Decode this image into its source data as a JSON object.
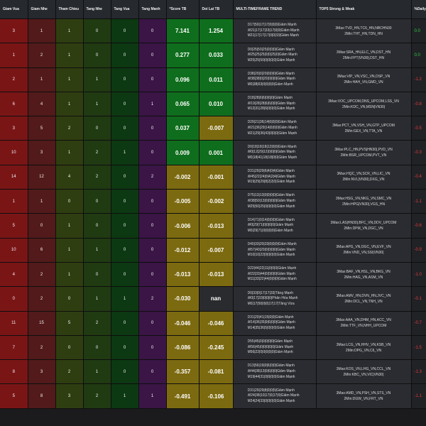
{
  "headers": [
    "Giam Vua",
    "Giam Nhe",
    "Tham Chieu",
    "Tang Nhe",
    "Tang Vua",
    "Tang Manh",
    "*Score TB",
    "Doi Lai TB",
    "MULTI-TIMEFRAME TREND",
    "TOP5 Strong & Weak",
    "%Daily"
  ],
  "colors": {
    "giam_vua": "#7a1516",
    "giam_nhe": "#521a1a",
    "tham_chieu": "#2f3e10",
    "tang_nhe": "#203a12",
    "tang_vua": "#0c3812",
    "tang_manh": "#3a1546",
    "metric_positive": "#0f6e1d",
    "metric_negative": "#7c6a10",
    "daily_up": "#2ecc40",
    "daily_down": "#e23b3b"
  },
  "rows": [
    {
      "giam_vua": "3",
      "giam_nhe": "1",
      "tham_chieu": "1",
      "tang_nhe": "0",
      "tang_vua": "0",
      "tang_manh": "0",
      "score": "7.141",
      "score_tone": "green",
      "doi_lai": "1.254",
      "doi_lai_tone": "green",
      "trend": [
        "D17|50|17|17|0|0|0|Giảm Mạnh",
        "W21|17|17|33|17|0|0|Giảm Mạnh",
        "M21|17|17|17|0|0|33|Giảm Mạnh"
      ],
      "top": [
        "3Max:TVD_HN,TC6_HN,NBCHN30",
        "2Min:THT_HN,TDN_HN"
      ],
      "daily": "0.0",
      "daily_tone": "up"
    },
    {
      "giam_vua": "1",
      "giam_nhe": "2",
      "tham_chieu": "1",
      "tang_nhe": "0",
      "tang_vua": "0",
      "tang_manh": "0",
      "score": "0.277",
      "score_tone": "green",
      "doi_lai": "0.033",
      "doi_lai_tone": "green",
      "trend": [
        "D0|25|50|25|0|0|0|Giảm Mạnh",
        "W25|25|25|0|0|25|0|Giảm Mạnh",
        "M25|25|50|0|0|0|0|Giảm Mạnh"
      ],
      "top": [
        "3Max:SRA_HN,ELC_VN,DST_HN",
        "2Min:FPT|VN30|,DST_HN"
      ],
      "daily": "0.0",
      "daily_tone": "up"
    },
    {
      "giam_vua": "2",
      "giam_nhe": "1",
      "tham_chieu": "1",
      "tang_nhe": "1",
      "tang_vua": "0",
      "tang_manh": "0",
      "score": "0.096",
      "score_tone": "green",
      "doi_lai": "0.011",
      "doi_lai_tone": "green",
      "trend": [
        "D38|20|0|20|0|0|0|Giảm Mạnh",
        "W38|38|0|20|0|0|0|Giảm Mạnh",
        "M0|38|63|0|0|0|0|Giảm Mạnh"
      ],
      "top": [
        "3Max:VIP_VN,VSC_VN,OSP_VN",
        "2Min:HAH_VN,GMD_VN"
      ],
      "daily": "-1.2",
      "daily_tone": "down"
    },
    {
      "giam_vua": "6",
      "giam_nhe": "4",
      "tham_chieu": "1",
      "tang_nhe": "1",
      "tang_vua": "0",
      "tang_manh": "1",
      "score": "0.065",
      "score_tone": "green",
      "doi_lai": "0.010",
      "doi_lai_tone": "green",
      "trend": [
        "D18|28|6|6|0|6|0|Giảm Mạnh",
        "W19|28|28|6|6|0|0|Giảm Mạnh",
        "M12|31|28|6|0|0|0|Giảm Mạnh"
      ],
      "top": [
        "3Max:VOC_UPCOM,DNS_UPCOM,LSS_VN",
        "2Min:KDC_VN,MSN|VN30|"
      ],
      "daily": "-0.8",
      "daily_tone": "down"
    },
    {
      "giam_vua": "3",
      "giam_nhe": "5",
      "tham_chieu": "2",
      "tang_nhe": "0",
      "tang_vua": "0",
      "tang_manh": "0",
      "score": "0.037",
      "score_tone": "green",
      "doi_lai": "-0.007",
      "doi_lai_tone": "olive",
      "trend": [
        "D29|21|36|14|0|0|0|Giảm Mạnh",
        "W21|36|29|14|0|0|0|Giảm Mạnh",
        "M21|29|36|43|0|0|0|Giảm Mạnh"
      ],
      "top": [
        "3Max:PCT_VN,VSH_VN,GTP_UPCOM",
        "2Min:GEX_VN,TTA_VN"
      ],
      "daily": "-0.5",
      "daily_tone": "down"
    },
    {
      "giam_vua": "10",
      "giam_nhe": "3",
      "tham_chieu": "1",
      "tang_nhe": "2",
      "tang_vua": "1",
      "tang_manh": "0",
      "score": "0.009",
      "score_tone": "green",
      "doi_lai": "0.001",
      "doi_lai_tone": "green",
      "trend": [
        "D0|18|18|18|12|0|0|Giảm Mạnh",
        "W0|12|29|12|0|0|0|Giảm Mạnh",
        "M0|18|41|18|18|0|0|Giảm Mạnh"
      ],
      "top": [
        "3Max:PLC_HN,PVS|HN30|,PVD_VN",
        "2Min:BSR_UPCOM,PVT_VN"
      ],
      "daily": "-0.3",
      "daily_tone": "down"
    },
    {
      "giam_vua": "14",
      "giam_nhe": "12",
      "tham_chieu": "4",
      "tang_nhe": "2",
      "tang_vua": "0",
      "tang_manh": "2",
      "score": "-0.002",
      "score_tone": "olive",
      "doi_lai": "-0.001",
      "doi_lai_tone": "olive",
      "trend": [
        "D31|29|29|6|4|0|4|Giảm Mạnh",
        "W45|22|24|0|4|2|4|Giảm Mạnh",
        "M19|29|29|8|2|2|0|Giảm Mạnh"
      ],
      "top": [
        "3Max:HQC_VN,SCR_VN,LIC_VN",
        "2Min:NVL|VN30|,DXG_VN"
      ],
      "daily": "-0.4",
      "daily_tone": "down"
    },
    {
      "giam_vua": "1",
      "giam_nhe": "1",
      "tham_chieu": "0",
      "tang_nhe": "0",
      "tang_vua": "0",
      "tang_manh": "0",
      "score": "-0.005",
      "score_tone": "olive",
      "doi_lai": "-0.002",
      "doi_lai_tone": "olive",
      "trend": [
        "D75|13|13|0|0|0|0|Giảm Mạnh",
        "W38|50|13|0|0|0|0|Giảm Mạnh",
        "M25|50|25|0|0|0|0|Giảm Mạnh"
      ],
      "top": [
        "3Max:HSG_VN,NKG_VN,SMC_VN",
        "2Min:HPG|VN30|,VGS_HN"
      ],
      "daily": "-1.1",
      "daily_tone": "down"
    },
    {
      "giam_vua": "5",
      "giam_nhe": "0",
      "tham_chieu": "1",
      "tang_nhe": "0",
      "tang_vua": "0",
      "tang_manh": "0",
      "score": "-0.006",
      "score_tone": "olive",
      "doi_lai": "-0.013",
      "doi_lai_tone": "olive",
      "trend": [
        "D14|71|0|14|0|0|0|Giảm Mạnh",
        "W0|29|71|0|0|0|0|Giảm Mạnh",
        "M0|29|71|0|0|0|0|Giảm Mạnh"
      ],
      "top": [
        "3Max:LAS|HN30|,BFC_VN,DDV_UPCOM",
        "2Min:DPM_VN,DGC_VN"
      ],
      "daily": "-0.6",
      "daily_tone": "down"
    },
    {
      "giam_vua": "10",
      "giam_nhe": "6",
      "tham_chieu": "1",
      "tang_nhe": "1",
      "tang_vua": "0",
      "tang_manh": "0",
      "score": "-0.012",
      "score_tone": "olive",
      "doi_lai": "-0.007",
      "doi_lai_tone": "olive",
      "trend": [
        "D40|33|20|33|0|0|0|Giảm Mạnh",
        "W57|40|20|0|0|0|0|Giảm Mạnh",
        "M10|10|22|0|0|0|0|Giảm Mạnh"
      ],
      "top": [
        "3Max:APG_VN,OGC_VN,EVF_VN",
        "2Min:VND_VN,SSI|VN30|"
      ],
      "daily": "-0.9",
      "daily_tone": "down"
    },
    {
      "giam_vua": "4",
      "giam_nhe": "2",
      "tham_chieu": "1",
      "tang_nhe": "0",
      "tang_vua": "0",
      "tang_manh": "0",
      "score": "-0.013",
      "score_tone": "olive",
      "doi_lai": "-0.013",
      "doi_lai_tone": "olive",
      "trend": [
        "D22|44|22|11|0|0|0|Giảm Mạnh",
        "W22|33|44|0|0|0|0|Giảm Mạnh",
        "M11|33|22|44|0|0|0|Giảm Mạnh"
      ],
      "top": [
        "3Max:BAF_VN,HSL_VN,BKG_VN",
        "2Min:HAG_VN,ASM_VN"
      ],
      "daily": "-1.0",
      "daily_tone": "down"
    },
    {
      "giam_vua": "0",
      "giam_nhe": "2",
      "tham_chieu": "0",
      "tang_nhe": "1",
      "tang_vua": "1",
      "tang_manh": "2",
      "score": "-0.030",
      "score_tone": "olive",
      "doi_lai": "nan",
      "doi_lai_tone": "dark",
      "trend": [
        "D0|33|0|17|17|33|Tăng Mạnh",
        "W0|17|33|0|0|0|Phân Hóa Mạnh",
        "M0|17|50|0|0|17|17|Tăng Vừa"
      ],
      "top": [
        "3Max:AMV_HN,DVN_HN,JVC_VN",
        "2Min:DCL_VN,TNH_VN"
      ],
      "daily": "-0.1",
      "daily_tone": "down"
    },
    {
      "giam_vua": "11",
      "giam_nhe": "15",
      "tham_chieu": "5",
      "tang_nhe": "2",
      "tang_vua": "0",
      "tang_manh": "0",
      "score": "-0.046",
      "score_tone": "olive",
      "doi_lai": "-0.046",
      "doi_lai_tone": "olive",
      "trend": [
        "D31|20|41|15|0|0|Giảm Mạnh",
        "W14|36|35|9|6|0|0|Giảm Mạnh",
        "M14|35|36|5|0|0|0|Giảm Mạnh"
      ],
      "top": [
        "3Max:AAA_VN,DHM_HN,ACC_VN",
        "2Min:TTF_VN,NHH_UPCOM"
      ],
      "daily": "-0.7",
      "daily_tone": "down"
    },
    {
      "giam_vua": "7",
      "giam_nhe": "2",
      "tham_chieu": "0",
      "tang_nhe": "0",
      "tang_vua": "0",
      "tang_manh": "0",
      "score": "-0.086",
      "score_tone": "olive",
      "doi_lai": "-0.245",
      "doi_lai_tone": "olive",
      "trend": [
        "D55|45|0|0|0|0|0|Giảm Mạnh",
        "W56|45|0|0|0|0|0|Giảm Mạnh",
        "M56|22|0|0|0|0|0|Giảm Mạnh"
      ],
      "top": [
        "3Max:LCG_VN,HHV_VN,KSB_VN",
        "2Min:DPG_VN,C6_VN"
      ],
      "daily": "-1.5",
      "daily_tone": "down"
    },
    {
      "giam_vua": "8",
      "giam_nhe": "3",
      "tham_chieu": "2",
      "tang_nhe": "1",
      "tang_vua": "0",
      "tang_manh": "0",
      "score": "-0.357",
      "score_tone": "olive",
      "doi_lai": "-0.081",
      "doi_lai_tone": "olive",
      "trend": [
        "D13|56|19|0|6|0|0|Giảm Mạnh",
        "W44|38|13|0|6|0|0|Giảm Mạnh",
        "M19|44|31|0|6|0|0|Giảm Mạnh"
      ],
      "top": [
        "3Max:KOS_VN,LHG_VN,CCL_VN",
        "2Min:KBC_VN,VIC|VN30|"
      ],
      "daily": "-1.3",
      "daily_tone": "down"
    },
    {
      "giam_vua": "5",
      "giam_nhe": "8",
      "tham_chieu": "3",
      "tang_nhe": "2",
      "tang_vua": "1",
      "tang_manh": "1",
      "score": "-0.491",
      "score_tone": "olive",
      "doi_lai": "-0.106",
      "doi_lai_tone": "olive",
      "trend": [
        "D31|29|29|8|0|0|5|Giảm Mạnh",
        "W24|38|10|17|0|17|0|Giảm Mạnh",
        "M24|24|33|0|0|0|0|Giảm Mạnh"
      ],
      "top": [
        "3Max:AMD_VN,PSH_VN,STS_VN",
        "2Min:DGW_VN,FRT_VN"
      ],
      "daily": "-1.1",
      "daily_tone": "down"
    }
  ]
}
